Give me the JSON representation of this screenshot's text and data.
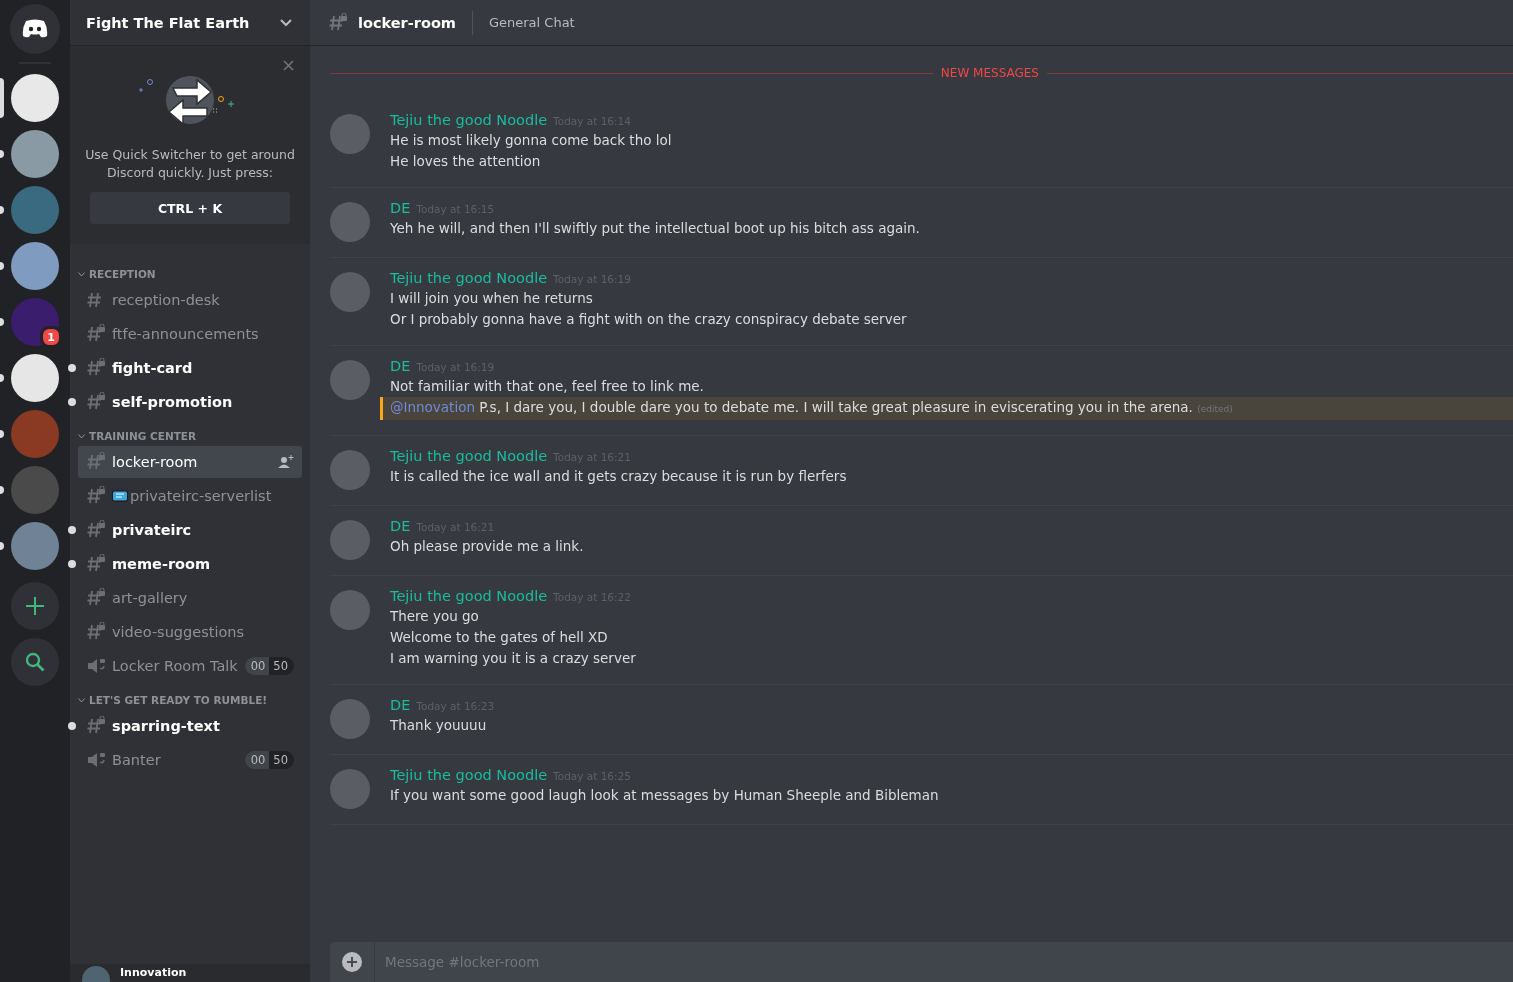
{
  "servers": [
    {
      "selected": true,
      "unread": false
    },
    {
      "selected": false,
      "unread": true
    },
    {
      "selected": false,
      "unread": true
    },
    {
      "selected": false,
      "unread": true
    },
    {
      "selected": false,
      "unread": true,
      "badge": "1"
    },
    {
      "selected": false,
      "unread": true
    },
    {
      "selected": false,
      "unread": true
    },
    {
      "selected": false,
      "unread": true
    },
    {
      "selected": false,
      "unread": true
    }
  ],
  "guild": {
    "name": "Fight The Flat Earth"
  },
  "tip": {
    "text": "Use Quick Switcher to get around Discord quickly. Just press:",
    "key": "CTRL + K"
  },
  "categories": [
    {
      "name": "RECEPTION",
      "channels": [
        {
          "kind": "text",
          "name": "reception-desk",
          "locked": false,
          "unread": false,
          "selected": false
        },
        {
          "kind": "text",
          "name": "ftfe-announcements",
          "locked": true,
          "unread": false,
          "selected": false
        },
        {
          "kind": "text",
          "name": "fight-card",
          "locked": true,
          "unread": true,
          "selected": false
        },
        {
          "kind": "text",
          "name": "self-promotion",
          "locked": true,
          "unread": true,
          "selected": false
        }
      ]
    },
    {
      "name": "TRAINING CENTER",
      "channels": [
        {
          "kind": "text",
          "name": "locker-room",
          "locked": true,
          "unread": false,
          "selected": true
        },
        {
          "kind": "text",
          "name": "privateirc-serverlist",
          "locked": true,
          "unread": false,
          "selected": false,
          "emoji": true
        },
        {
          "kind": "text",
          "name": "privateirc",
          "locked": true,
          "unread": true,
          "selected": false
        },
        {
          "kind": "text",
          "name": "meme-room",
          "locked": true,
          "unread": true,
          "selected": false
        },
        {
          "kind": "text",
          "name": "art-gallery",
          "locked": true,
          "unread": false,
          "selected": false
        },
        {
          "kind": "text",
          "name": "video-suggestions",
          "locked": true,
          "unread": false,
          "selected": false
        },
        {
          "kind": "voice",
          "name": "Locker Room Talk",
          "locked": true,
          "unread": false,
          "selected": false,
          "users": "00",
          "limit": "50"
        }
      ]
    },
    {
      "name": "LET'S GET READY TO RUMBLE!",
      "channels": [
        {
          "kind": "text",
          "name": "sparring-text",
          "locked": true,
          "unread": true,
          "selected": false
        },
        {
          "kind": "voice",
          "name": "Banter",
          "locked": true,
          "unread": false,
          "selected": false,
          "users": "00",
          "limit": "50"
        }
      ]
    }
  ],
  "user": {
    "name": "Innovation"
  },
  "header": {
    "channel": "locker-room",
    "topic": "General Chat"
  },
  "new_messages": "NEW MESSAGES",
  "messages": [
    {
      "author": "Tejiu the good Noodle",
      "time": "Today at 16:14",
      "lines": [
        {
          "text": "He is most likely gonna come back tho lol"
        },
        {
          "text": "He loves the attention"
        }
      ]
    },
    {
      "author": "DE",
      "time": "Today at 16:15",
      "lines": [
        {
          "text": "Yeh he will, and then I'll swiftly put the intellectual boot up his bitch ass again."
        }
      ]
    },
    {
      "author": "Tejiu the good Noodle",
      "time": "Today at 16:19",
      "lines": [
        {
          "text": "I will join you when he returns"
        },
        {
          "text": "Or I probably gonna have a fight with on the crazy conspiracy debate server"
        }
      ]
    },
    {
      "author": "DE",
      "time": "Today at 16:19",
      "lines": [
        {
          "text": "Not familiar with that one, feel free to link me."
        },
        {
          "mention": "@Innovation",
          "text": "P.s, I dare you, I double dare you to debate me. I will take great pleasure in eviscerating you in the arena.",
          "highlighted": true,
          "edited": "(edited)"
        }
      ]
    },
    {
      "author": "Tejiu the good Noodle",
      "time": "Today at 16:21",
      "lines": [
        {
          "text": "It is called the ice wall and it gets crazy because it is run by flerfers"
        }
      ]
    },
    {
      "author": "DE",
      "time": "Today at 16:21",
      "lines": [
        {
          "text": "Oh please provide me a link."
        }
      ]
    },
    {
      "author": "Tejiu the good Noodle",
      "time": "Today at 16:22",
      "lines": [
        {
          "text": "There you go"
        },
        {
          "text": "Welcome to the gates of hell XD"
        },
        {
          "text": "I am warning you it is a crazy server"
        }
      ]
    },
    {
      "author": "DE",
      "time": "Today at 16:23",
      "lines": [
        {
          "text": "Thank youuuu"
        }
      ]
    },
    {
      "author": "Tejiu the good Noodle",
      "time": "Today at 16:25",
      "lines": [
        {
          "text": "If you want some good laugh look at messages by Human Sheeple and Bibleman"
        }
      ]
    }
  ],
  "composer": {
    "placeholder": "Message #locker-room"
  }
}
